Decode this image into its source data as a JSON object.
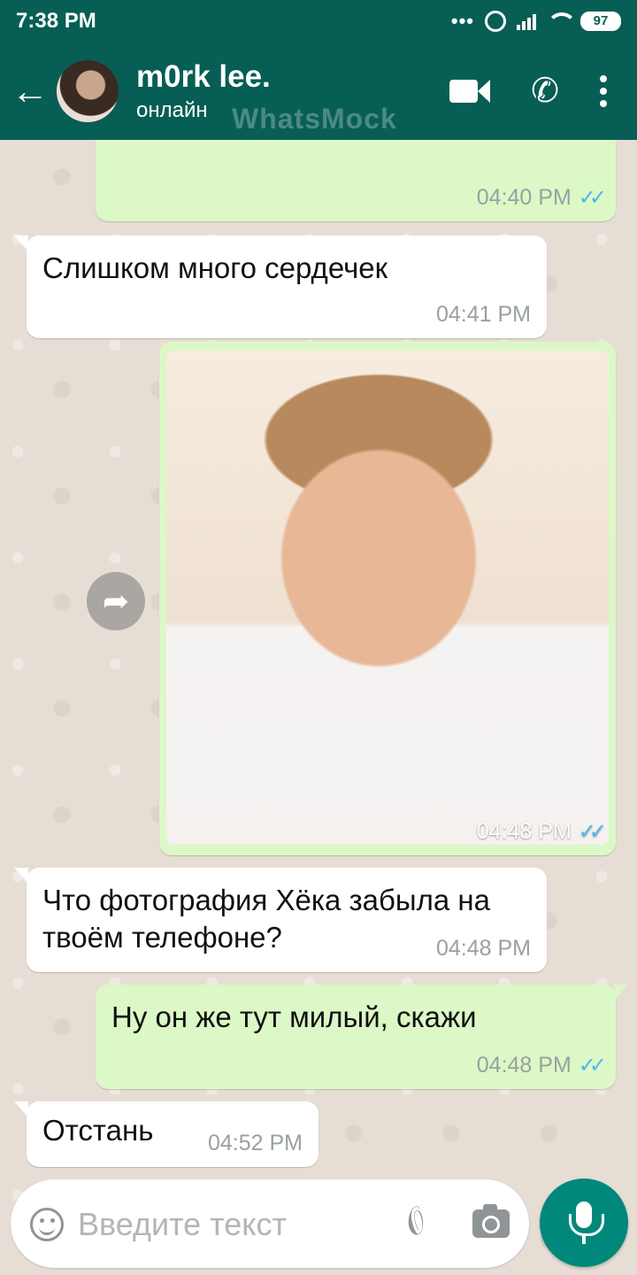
{
  "status_bar": {
    "time": "7:38 PM",
    "battery": "97"
  },
  "header": {
    "contact_name": "m0rk lee.",
    "contact_status": "онлайн",
    "watermark": "WhatsMock"
  },
  "messages": [
    {
      "type": "out",
      "content": "💗💗💗💘💘💘❤️❤️❤️",
      "time": "04:40 PM",
      "read": true
    },
    {
      "type": "in",
      "content": "Слишком много сердечек",
      "time": "04:41 PM"
    },
    {
      "type": "out-image",
      "time": "04:48 PM",
      "read": true
    },
    {
      "type": "in",
      "content": "Что фотография Хёка забыла на твоём телефоне?",
      "time": "04:48 PM"
    },
    {
      "type": "out",
      "content": "Ну он же тут милый, скажи",
      "time": "04:48 PM",
      "read": true
    },
    {
      "type": "in",
      "content": "Отстань",
      "time": "04:52 PM"
    }
  ],
  "input": {
    "placeholder": "Введите текст"
  },
  "colors": {
    "header": "#075e54",
    "outgoing_bubble": "#dcf8c6",
    "incoming_bubble": "#ffffff",
    "read_ticks": "#4fb6ec",
    "mic_button": "#00897b"
  },
  "icons": [
    "back-arrow-icon",
    "video-call-icon",
    "phone-icon",
    "more-menu-icon",
    "forward-icon",
    "emoji-icon",
    "attach-icon",
    "camera-icon",
    "mic-icon"
  ]
}
